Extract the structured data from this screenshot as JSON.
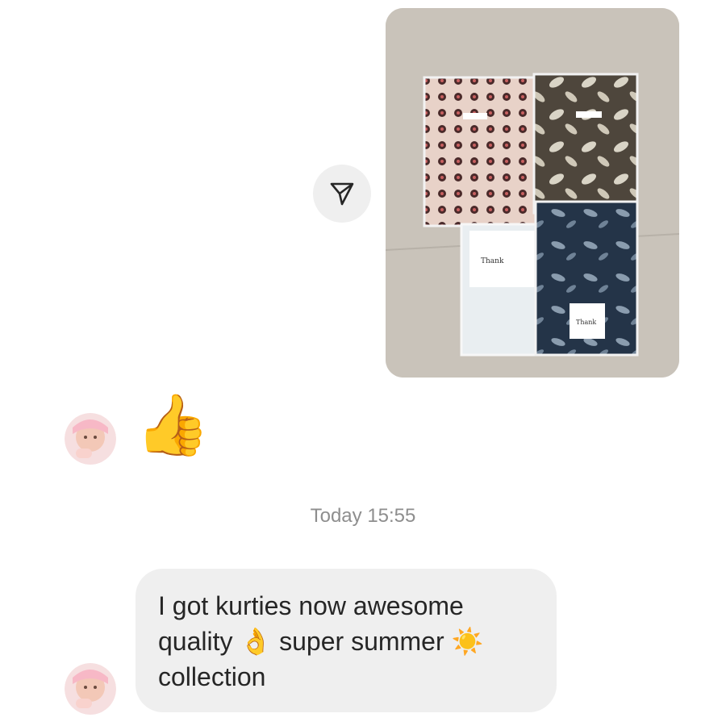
{
  "conversation": {
    "shared_photo": {
      "alt": "photo",
      "share_icon": "paper-plane-icon"
    },
    "reply_reaction": {
      "avatar_icon": "baby-avatar-icon",
      "emoji": "👍"
    },
    "timestamp": "Today 15:55",
    "message": {
      "avatar_icon": "baby-avatar-icon",
      "line1": "I got kurties now awesome",
      "line2_part1": "quality",
      "emoji_ok": "👌",
      "line2_part2": "super summer",
      "emoji_sun": "☀️",
      "line3": "collection"
    }
  },
  "colors": {
    "bubble_bg": "#efefef",
    "timestamp_text": "#8e8e8e",
    "message_text": "#262626"
  }
}
